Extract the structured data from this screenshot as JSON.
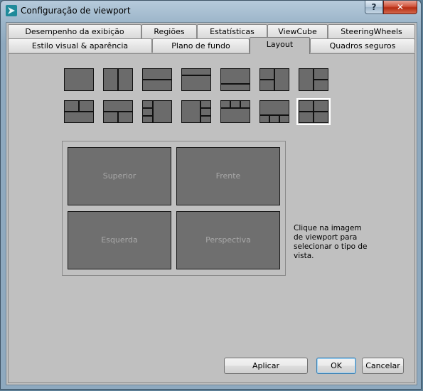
{
  "window": {
    "title": "Configuração de viewport",
    "help_label": "?",
    "close_label": "✕",
    "app_icon": "autodesk-3dsmax-logo"
  },
  "tabs": {
    "row_top": [
      "Desempenho da exibição",
      "Regiões",
      "Estatísticas",
      "ViewCube",
      "SteeringWheels"
    ],
    "row_bottom": [
      "Estilo visual & aparência",
      "Plano de fundo",
      "Layout",
      "Quadros seguros"
    ],
    "active": "Layout"
  },
  "layouts": {
    "count": 14,
    "selected_index": 13,
    "selected_name": "2x2 grid"
  },
  "preview": {
    "viewports": [
      "Superior",
      "Frente",
      "Esquerda",
      "Perspectiva"
    ]
  },
  "hint": "Clique na imagem de viewport para selecionar o tipo de vista.",
  "buttons": {
    "apply": "Aplicar",
    "ok": "OK",
    "cancel": "Cancelar"
  },
  "colors": {
    "panel_bg": "#c0c0c0",
    "viewport_fill": "#6f6f6f",
    "viewport_label": "#a8a8a8",
    "close_red": "#c23a1f"
  }
}
